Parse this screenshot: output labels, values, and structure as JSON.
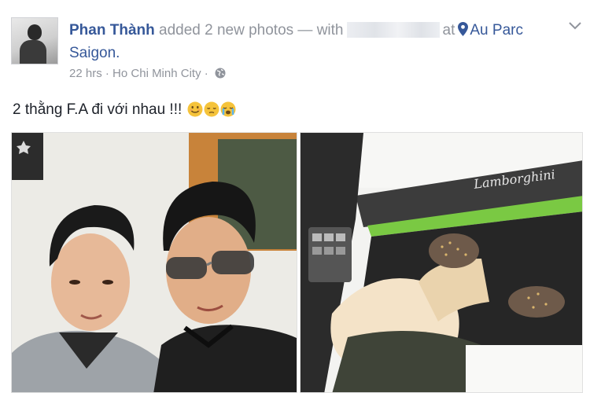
{
  "post": {
    "author": "Phan Thành",
    "action": "added 2 new photos — with",
    "at": "at",
    "place": "Au Parc Saigon.",
    "timestamp": "22 hrs",
    "separator": "·",
    "location": "Ho Chi Minh City",
    "text": "2 thằng F.A đi với nhau !!!"
  },
  "photos": {
    "logo_text": "Lamborghini"
  },
  "icons": {
    "pin": "map-pin-icon",
    "globe": "globe-icon",
    "chevron": "chevron-down-icon",
    "emojis": [
      "smile-emoji",
      "pensive-emoji",
      "crying-emoji"
    ]
  },
  "colors": {
    "link": "#365899",
    "meta": "#90949c",
    "text": "#1d2129",
    "lambo_green": "#7ac943"
  }
}
